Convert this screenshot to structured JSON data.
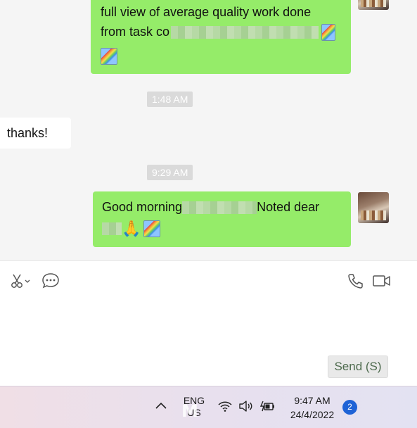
{
  "messages": [
    {
      "id": "m1",
      "side": "right",
      "lines": [
        "full view of average quality work done",
        "from task co"
      ]
    },
    {
      "id": "m2",
      "side": "left",
      "text": "thanks!"
    },
    {
      "id": "m3",
      "side": "right",
      "prefix": "Good morning",
      "suffix": "Noted dear"
    }
  ],
  "timestamps": [
    "1:48 AM",
    "9:29 AM"
  ],
  "toolbar": {
    "left_icons": [
      "scissors-icon",
      "chat-bubble-icon"
    ],
    "right_icons": [
      "phone-icon",
      "video-call-icon"
    ]
  },
  "send_button": "Send (S)",
  "taskbar": {
    "lang_top": "ENG",
    "lang_bottom": "US",
    "time": "9:47 AM",
    "date": "24/4/2022",
    "notification_count": "2",
    "icons": [
      "chevron-up-icon",
      "wifi-icon",
      "speaker-icon",
      "battery-charging-icon"
    ]
  }
}
